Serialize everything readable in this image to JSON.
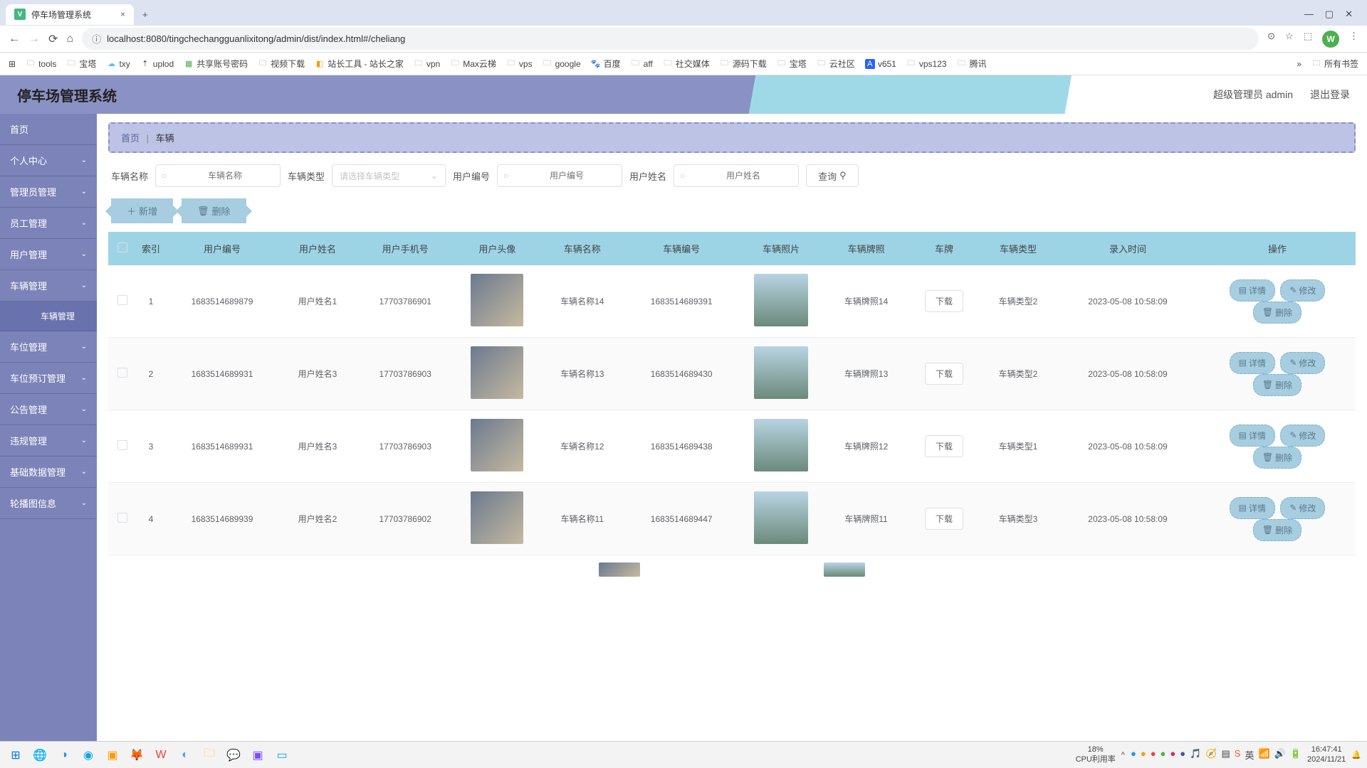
{
  "browser": {
    "tab_title": "停车场管理系统",
    "url": "localhost:8080/tingchechangguanlixitong/admin/dist/index.html#/cheliang",
    "bookmarks": [
      "tools",
      "宝塔",
      "txy",
      "uplod",
      "共享账号密码",
      "视频下载",
      "站长工具 - 站长之家",
      "vpn",
      "Max云梯",
      "vps",
      "google",
      "百度",
      "aff",
      "社交媒体",
      "源码下载",
      "宝塔",
      "云社区",
      "v651",
      "vps123",
      "腾讯"
    ],
    "all_bookmarks": "所有书签",
    "profile_initial": "W"
  },
  "header": {
    "title": "停车场管理系统",
    "admin_label": "超级管理员 admin",
    "logout": "退出登录"
  },
  "sidebar": {
    "items": [
      "首页",
      "个人中心",
      "管理员管理",
      "员工管理",
      "用户管理",
      "车辆管理",
      "车位管理",
      "车位预订管理",
      "公告管理",
      "违规管理",
      "基础数据管理",
      "轮播图信息"
    ],
    "sub_item": "车辆管理"
  },
  "breadcrumb": {
    "home": "首页",
    "current": "车辆"
  },
  "search": {
    "label_name": "车辆名称",
    "ph_name": "车辆名称",
    "label_type": "车辆类型",
    "ph_type": "请选择车辆类型",
    "label_userno": "用户编号",
    "ph_userno": "用户编号",
    "label_username": "用户姓名",
    "ph_username": "用户姓名",
    "btn_query": "查询"
  },
  "actions": {
    "add": "新增",
    "delete": "删除"
  },
  "table": {
    "headers": [
      "",
      "索引",
      "用户编号",
      "用户姓名",
      "用户手机号",
      "用户头像",
      "车辆名称",
      "车辆编号",
      "车辆照片",
      "车辆牌照",
      "车牌",
      "车辆类型",
      "录入时间",
      "操作"
    ],
    "download": "下载",
    "op_detail": "详情",
    "op_edit": "修改",
    "op_delete": "删除",
    "rows": [
      {
        "idx": "1",
        "userno": "1683514689879",
        "username": "用户姓名1",
        "phone": "17703786901",
        "vname": "车辆名称14",
        "vno": "1683514689391",
        "plate": "车辆牌照14",
        "vtype": "车辆类型2",
        "time": "2023-05-08 10:58:09"
      },
      {
        "idx": "2",
        "userno": "1683514689931",
        "username": "用户姓名3",
        "phone": "17703786903",
        "vname": "车辆名称13",
        "vno": "1683514689430",
        "plate": "车辆牌照13",
        "vtype": "车辆类型2",
        "time": "2023-05-08 10:58:09"
      },
      {
        "idx": "3",
        "userno": "1683514689931",
        "username": "用户姓名3",
        "phone": "17703786903",
        "vname": "车辆名称12",
        "vno": "1683514689438",
        "plate": "车辆牌照12",
        "vtype": "车辆类型1",
        "time": "2023-05-08 10:58:09"
      },
      {
        "idx": "4",
        "userno": "1683514689939",
        "username": "用户姓名2",
        "phone": "17703786902",
        "vname": "车辆名称11",
        "vno": "1683514689447",
        "plate": "车辆牌照11",
        "vtype": "车辆类型3",
        "time": "2023-05-08 10:58:09"
      }
    ]
  },
  "taskbar": {
    "cpu_pct": "18%",
    "cpu_label": "CPU利用率",
    "time": "16:47:41",
    "date": "2024/11/21"
  }
}
